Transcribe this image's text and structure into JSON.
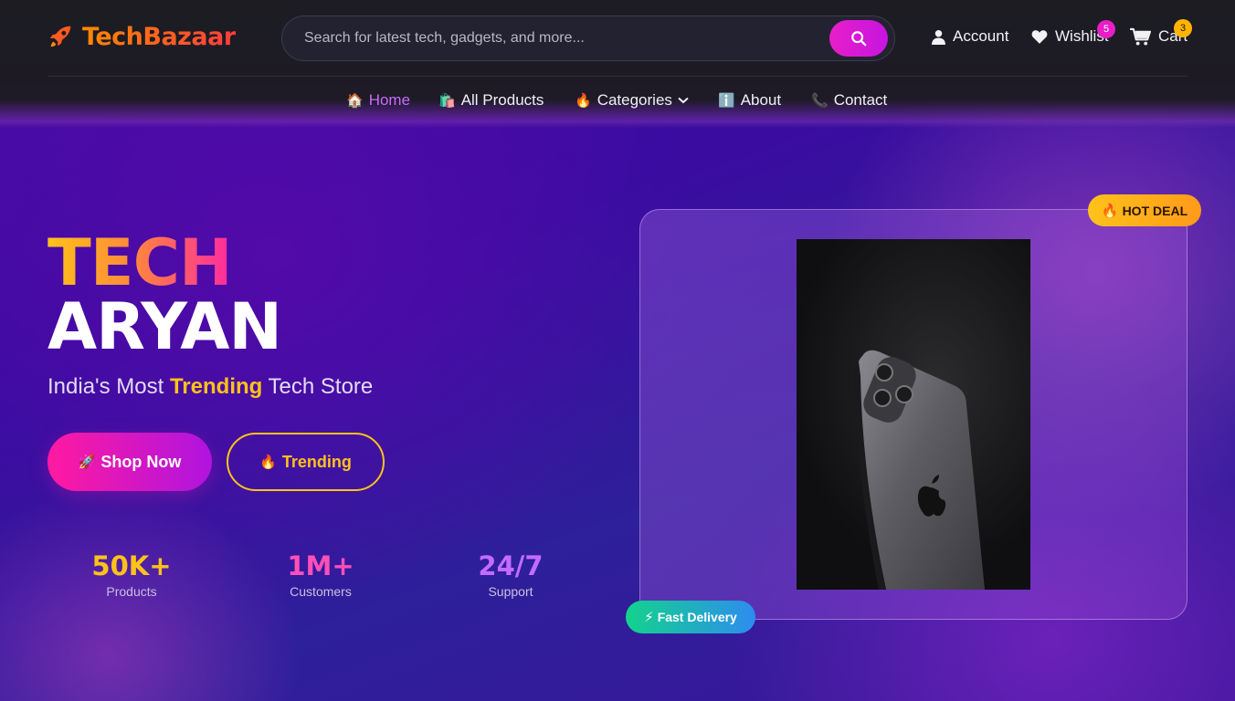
{
  "brand": {
    "name": "TechBazaar"
  },
  "search": {
    "placeholder": "Search for latest tech, gadgets, and more..."
  },
  "header_links": {
    "account": "Account",
    "wishlist": "Wishlist",
    "wishlist_count": "5",
    "cart": "Cart",
    "cart_count": "3"
  },
  "nav": {
    "items": [
      {
        "emoji": "🏠",
        "label": "Home",
        "active": true
      },
      {
        "emoji": "🛍️",
        "label": "All Products"
      },
      {
        "emoji": "🔥",
        "label": "Categories"
      },
      {
        "emoji": "ℹ️",
        "label": "About"
      },
      {
        "emoji": "📞",
        "label": "Contact"
      }
    ]
  },
  "hero": {
    "title_line1": "TECH",
    "title_line2": "ARYAN",
    "subtitle_pre": "India's Most ",
    "subtitle_highlight": "Trending",
    "subtitle_post": " Tech Store",
    "shop_button": {
      "emoji": "🚀",
      "label": "Shop Now"
    },
    "trending_button": {
      "emoji": "🔥",
      "label": "Trending"
    }
  },
  "stats": [
    {
      "value": "50K+",
      "label": "Products",
      "color": "#ffc21a"
    },
    {
      "value": "1M+",
      "label": "Customers",
      "color": "#ff4fb8"
    },
    {
      "value": "24/7",
      "label": "Support",
      "color": "#c46bff"
    }
  ],
  "product_card": {
    "hot_deal": {
      "emoji": "🔥",
      "label": "HOT DEAL"
    },
    "fast_delivery": {
      "emoji": "⚡",
      "label": "Fast Delivery"
    },
    "image_icon": "smartphone-product-image"
  },
  "colors": {
    "accent_pink": "#e81ec8",
    "accent_yellow": "#ffc21a",
    "brand_orange": "#ff5a1f",
    "nav_active": "#c86cff"
  }
}
